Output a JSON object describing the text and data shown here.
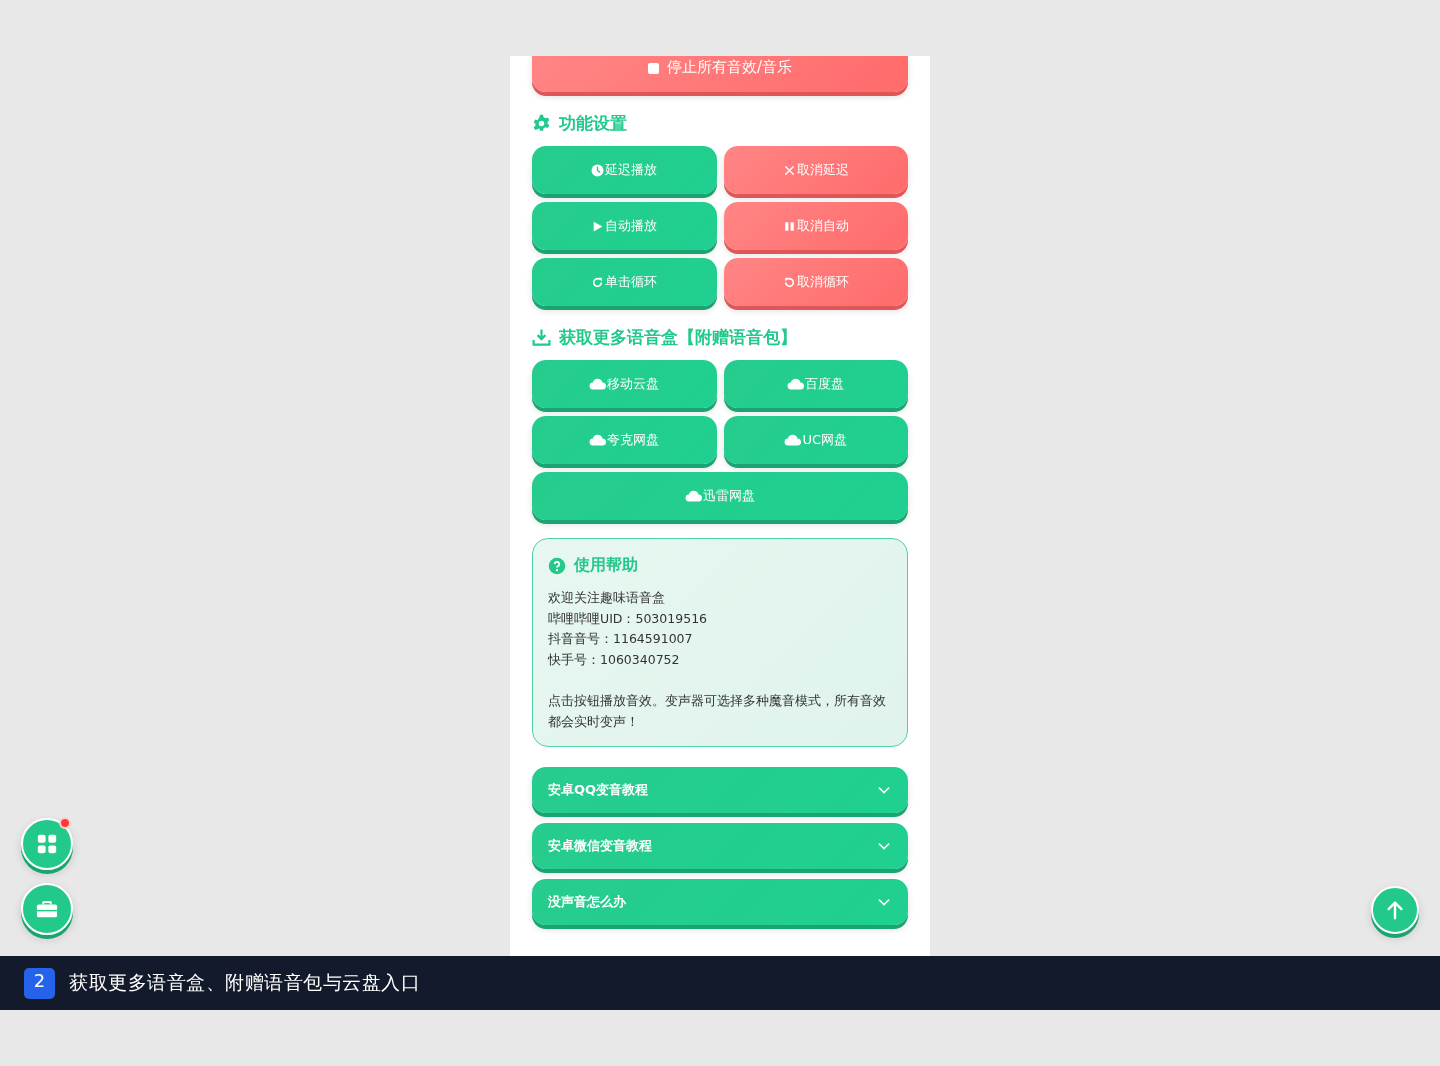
{
  "stop_button": {
    "label": "停止所有音效/音乐"
  },
  "settings": {
    "title": "功能设置",
    "buttons": [
      {
        "label": "延迟播放",
        "kind": "delay"
      },
      {
        "label": "取消延迟",
        "kind": "cancel-delay"
      },
      {
        "label": "自动播放",
        "kind": "autoplay"
      },
      {
        "label": "取消自动",
        "kind": "cancel-auto"
      },
      {
        "label": "单击循环",
        "kind": "loop"
      },
      {
        "label": "取消循环",
        "kind": "cancel-loop"
      }
    ]
  },
  "downloads": {
    "title": "获取更多语音盒【附赠语音包】",
    "buttons": [
      {
        "label": "移动云盘"
      },
      {
        "label": "百度盘"
      },
      {
        "label": "夸克网盘"
      },
      {
        "label": "UC网盘"
      },
      {
        "label": "迅雷网盘"
      }
    ]
  },
  "help": {
    "title": "使用帮助",
    "lines": [
      "欢迎关注趣味语音盒",
      "哔哩哔哩UID：503019516",
      "抖音音号：1164591007",
      "快手号：1060340752"
    ],
    "note": "点击按钮播放音效。变声器可选择多种魔音模式，所有音效都会实时变声！"
  },
  "faq": [
    {
      "label": "安卓QQ变音教程",
      "expanded": false
    },
    {
      "label": "安卓微信变音教程",
      "expanded": false
    },
    {
      "label": "没声音怎么办",
      "expanded": false
    }
  ],
  "floating": {
    "apps_notification": true
  },
  "caption": {
    "step": "2",
    "text": "获取更多语音盒、附赠语音包与云盘入口"
  }
}
